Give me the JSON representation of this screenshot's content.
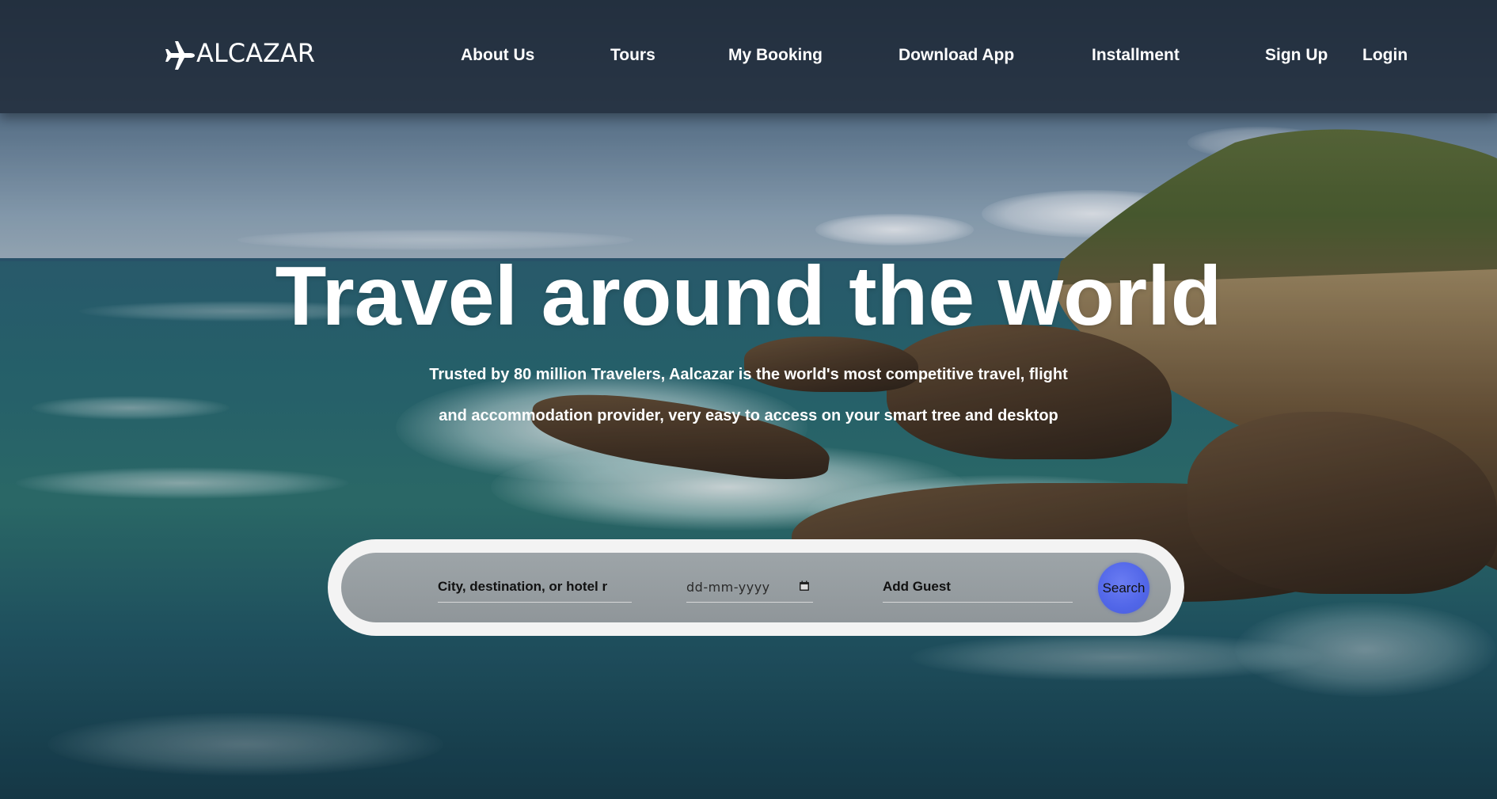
{
  "brand": {
    "logo_text": "ALCAZAR",
    "logo_icon": "airplane-icon"
  },
  "nav": {
    "about": "About Us",
    "tours": "Tours",
    "booking": "My Booking",
    "download": "Download App",
    "installment": "Installment",
    "signup": "Sign Up",
    "login": "Login"
  },
  "hero": {
    "title": "Travel around the world",
    "subtitle_line1": "Trusted by 80 million Travelers, Aalcazar is the world's most competitive travel, flight",
    "subtitle_line2": "and accommodation provider, very easy to access on your smart tree and desktop"
  },
  "search": {
    "destination_placeholder": "City, destination, or hotel r",
    "date_placeholder": "dd-mm-yyyy",
    "date_icon": "calendar-icon",
    "guest_placeholder": "Add Guest",
    "button_label": "Search"
  },
  "colors": {
    "navbar": "#222e3c",
    "search_button": "#5166e8",
    "pill": "#f3f3f3"
  }
}
